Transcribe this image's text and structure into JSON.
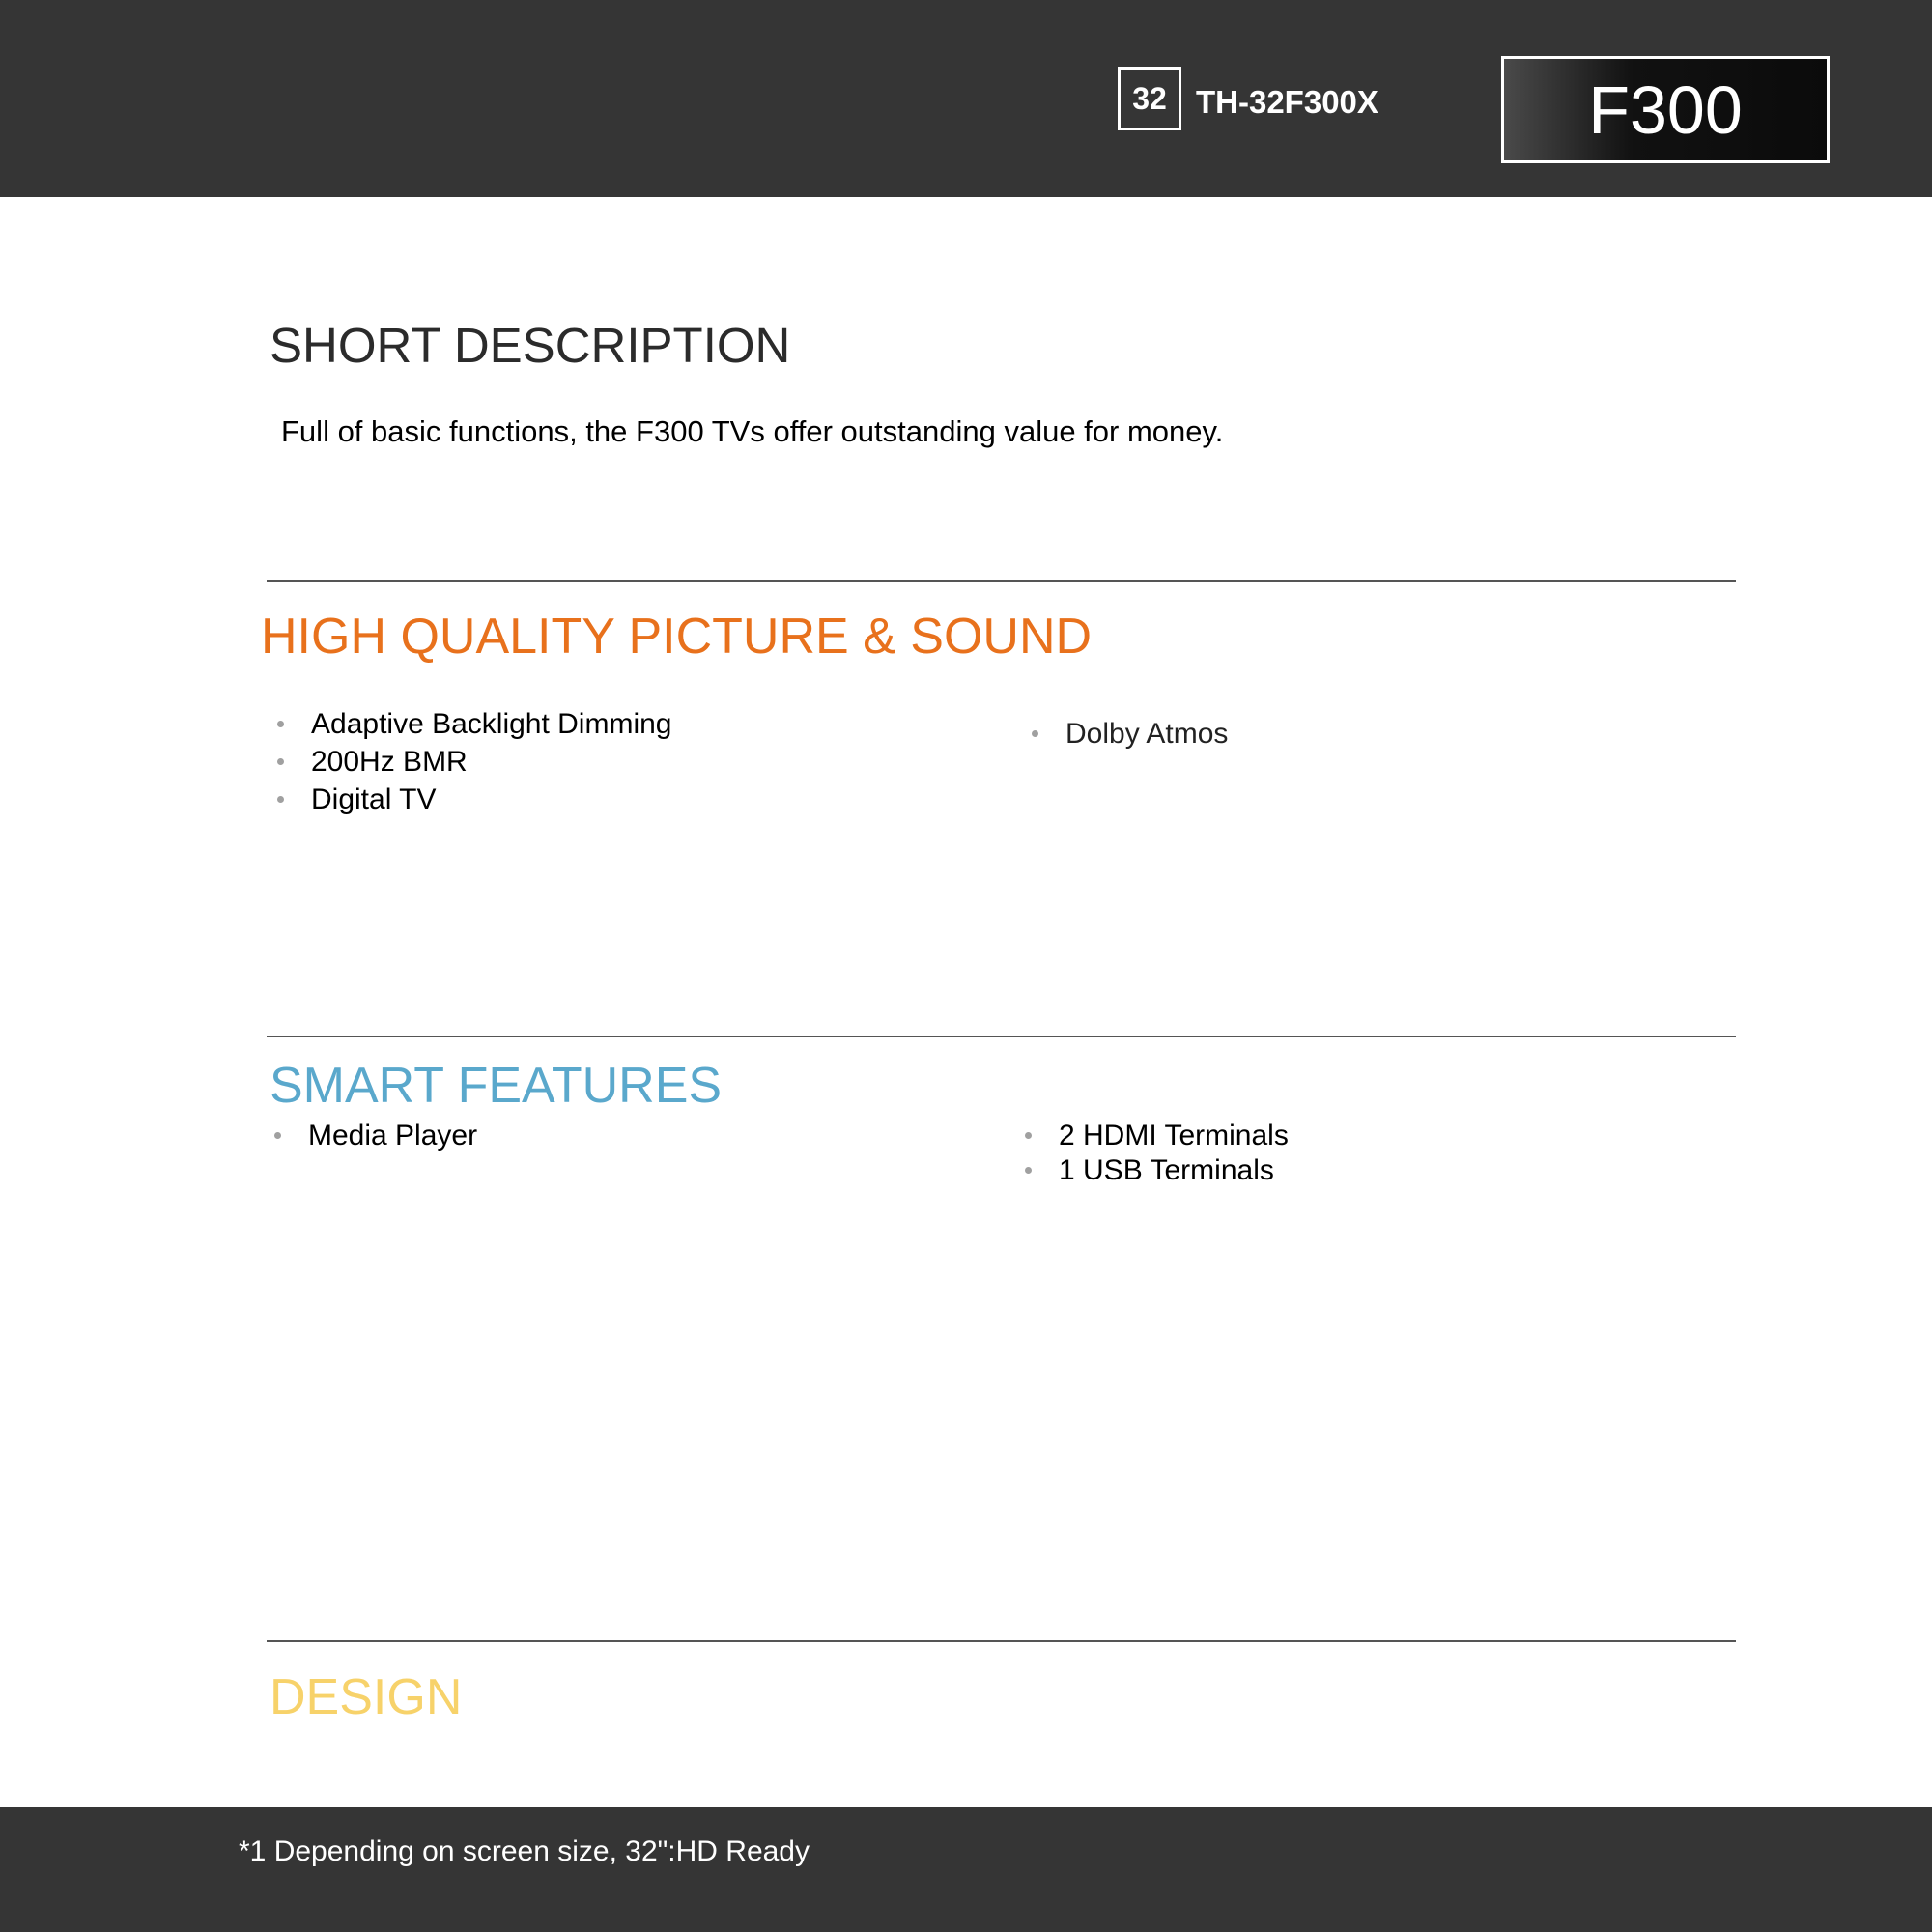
{
  "header": {
    "size_label": "32",
    "model_code": "TH-32F300X",
    "series_label": "F300"
  },
  "short_description": {
    "title": "SHORT DESCRIPTION",
    "text": "Full of basic functions, the F300 TVs offer outstanding value for money."
  },
  "picture_sound": {
    "title": "HIGH QUALITY PICTURE & SOUND",
    "left_items": [
      "Adaptive Backlight Dimming",
      "200Hz BMR",
      "Digital TV"
    ],
    "right_items": [
      "Dolby Atmos"
    ]
  },
  "smart_features": {
    "title": "SMART FEATURES",
    "left_items": [
      "Media Player"
    ],
    "right_items": [
      "2 HDMI Terminals",
      "1 USB Terminals"
    ]
  },
  "design": {
    "title": "DESIGN"
  },
  "footer": {
    "footnote": "*1 Depending on screen size, 32\":HD Ready"
  },
  "colors": {
    "header_bg": "#353535",
    "picture_sound_accent": "#e8711c",
    "smart_features_accent": "#5aa8cc",
    "design_accent": "#f7d26a"
  }
}
